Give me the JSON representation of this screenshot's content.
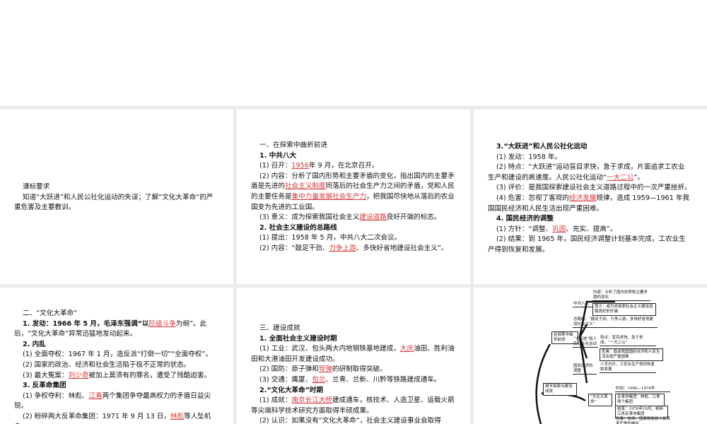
{
  "slide1": {
    "heading": "课标要求",
    "body": "知道“大跃进”和人民公社化运动的失误；了解“文化大革命”的严重危害及主要教训。"
  },
  "slide2": {
    "l1": "一、在探索中曲折前进",
    "l2": "1. 中共八大",
    "l3a": "(1) 召开：",
    "l3r": "1956",
    "l3b": "年 9 月，在北京召开。",
    "l4a": "(2) 内容：分析了国内形势和主要矛盾的变化，指出国内的主要矛盾是先进的",
    "l4r": "社会主义制度",
    "l4b": "同落后的社会生产力之间的矛盾，党和人民的主要任务是",
    "l4r2": "集中力量发展社会生产力",
    "l4c": "，把我国尽快地从落后的农业国变为先进的工业国。",
    "l5a": "(3) 意义：成为探索我国社会主义",
    "l5r": "建设道路",
    "l5b": "良好开端的标志。",
    "l6": "2. 社会主义建设的总路线",
    "l7": "(1) 提出：1958 年 5 月，中共八大二次会议。",
    "l8a": "(2) 内容：“鼓足干劲、",
    "l8r": "力争上游",
    "l8b": "、多快好省地建设社会主义”。"
  },
  "slide3": {
    "l1": "3.“大跃进”和人民公社化运动",
    "l2": "(1) 发动：1958 年。",
    "l3a": "(2) 特点：“大跃进”运动盲目求快，急于求成，片面追求工农业生产和建设的高速度。人民公社化运动“",
    "l3r": "一大二公",
    "l3b": "”。",
    "l4": "(3) 评价：是我国探索建设社会主义道路过程中的一次严重挫折。",
    "l5a": "(4) 危害：忽视了客观的",
    "l5r": "经济发展",
    "l5b": "规律，造成 1959—1961 年我国国民经济和人民生活出现严重困难。",
    "l6": "4. 国民经济的调整",
    "l7a": "(1) 方针：“调整、",
    "l7r": "巩固",
    "l7b": "、充实、提高”。",
    "l8": "(2) 结果：到 1965 年，国民经济调整计划基本完成，工农业生产得到恢复和发展。"
  },
  "slide4": {
    "l1": "二、“文化大革命”",
    "l2a": "1. 发动：1966 年 5 月，毛泽东强调“以",
    "l2r": "阶级斗争",
    "l2b": "为纲”。此后，“文化大革命”异常迅猛地发动起来。",
    "l3": "2. 内乱",
    "l4": "(1) 全面夺权：1967 年 1 月，造反派“打倒一切”“全面夺权”。",
    "l5": "(2) 国家的政治、经济和社会生活陷于极不正常的状态。",
    "l6a": "(3) 最大冤案：",
    "l6r": "刘少奇",
    "l6b": "被加上莫须有的罪名，遭受了残酷迫害。",
    "l7": "3. 反革命集团",
    "l8a": "(1) 争权夺利：林彪、",
    "l8r": "江青",
    "l8b": "两个集团争夺最高权力的矛盾日益尖锐。",
    "l9a": "(2) 粉碎两大反革命集团：1971 年 9 月 13 日，",
    "l9r": "林彪",
    "l9b": "等人坠机身"
  },
  "slide5": {
    "l1": "三、建设成就",
    "l2": "1. 全面社会主义建设时期",
    "l3a": "(1) 工业：武汉、包头两大内地钢铁基地建成，",
    "l3r": "大庆",
    "l3b": "油田、胜利油田和大港油田开发建设成功。",
    "l4a": "(2) 国防：原子弹和",
    "l4r": "导弹",
    "l4b": "的研制取得突破。",
    "l5a": "(3) 交通：鹰厦、",
    "l5r": "包兰",
    "l5b": "、兰青、兰新、川黔等铁路建成通车。",
    "l6": "2.“文化大革命”时期",
    "l7a": "(1) 成就：",
    "l7r": "南京长江大桥",
    "l7b": "建成通车，核技术、人造卫星、运载火箭等尖端科学技术研究方面取得丰硕成果。",
    "l8": "(2) 认识：如果没有“文化大革命”，社会主义建设事业会取得"
  },
  "mindmap": {
    "root": "艰辛探索与建设成就",
    "b1": "在探索中曲折前进",
    "b1a": "中共八大",
    "b1a1": "内容：分析了国内形势和主要矛盾的变化",
    "b1a2": "意义：成为党探索社会主义建设道路良好的开端",
    "b1b": "总路线：“鼓足干劲、力争上游、多快好省地建设社会主义”",
    "b1c": "“大跃进”和人民公社化运动",
    "b1c1": "特点：盲目求快，急于求成，“一大二公”",
    "b1c2": "危害：造成我国国民经济和人民生活出现严重困难",
    "b1d": "国民经济的调整",
    "b1d1": "八字方针，工农业生产得到恢复和发展",
    "b2": "“文化大革命”",
    "b2a": "时间：1966—1976年",
    "b2b": "反革命集团：林彪、江青两个集团",
    "b2c": "结束：1976年10月，粉碎江青反革命集团",
    "b2d": "危害：给党、国家和各族人民带来严重的挫折"
  }
}
